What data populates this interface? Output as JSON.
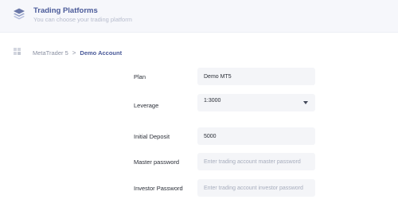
{
  "header": {
    "title": "Trading Platforms",
    "subtitle": "You can choose your trading platform",
    "icon": "layers-icon"
  },
  "breadcrumb": {
    "parent": "MetaTrader 5",
    "separator": ">",
    "current": "Demo Account"
  },
  "form": {
    "plan": {
      "label": "Plan",
      "value": "Demo MT5"
    },
    "leverage": {
      "label": "Leverage",
      "value": "1:3000"
    },
    "initial_deposit": {
      "label": "Initial Deposit",
      "value": "5000"
    },
    "master_password": {
      "label": "Master password",
      "placeholder": "Enter trading account master password"
    },
    "investor_password": {
      "label": "Investor Password",
      "placeholder": "Enter trading account investor password"
    }
  },
  "colors": {
    "accent": "#4a5a99",
    "field_bg": "#f4f5f8",
    "header_bg": "#f6f7fb"
  }
}
